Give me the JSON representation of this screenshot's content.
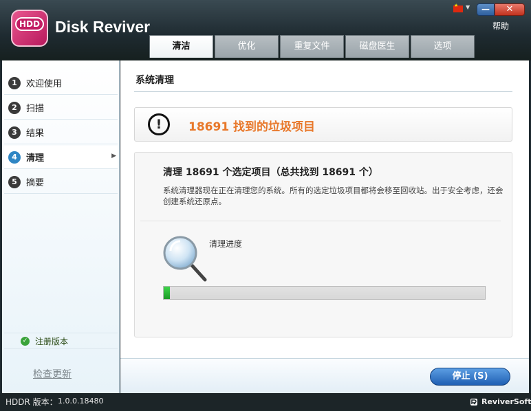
{
  "app": {
    "logo_text": "HDD",
    "title": "Disk Reviver",
    "help": "帮助",
    "minimize": "—",
    "close": "✕"
  },
  "tabs": [
    {
      "label": "清洁",
      "active": true
    },
    {
      "label": "优化",
      "active": false
    },
    {
      "label": "重复文件",
      "active": false
    },
    {
      "label": "磁盘医生",
      "active": false
    },
    {
      "label": "选项",
      "active": false
    }
  ],
  "sidebar": {
    "items": [
      {
        "num": "1",
        "label": "欢迎使用"
      },
      {
        "num": "2",
        "label": "扫描"
      },
      {
        "num": "3",
        "label": "结果"
      },
      {
        "num": "4",
        "label": "清理",
        "active": true
      },
      {
        "num": "5",
        "label": "摘要"
      }
    ],
    "registered": "注册版本",
    "check_update": "检查更新"
  },
  "main": {
    "section_title": "系统清理",
    "alert": "18691 找到的垃圾项目",
    "heading": "清理 18691 个选定项目（总共找到 18691 个）",
    "description": "系统清理器现在正在清理您的系统。所有的选定垃圾项目都将会移至回收站。出于安全考虑，还会创建系统还原点。",
    "progress_label": "清理进度",
    "progress_fraction": 0.02,
    "stop_button": "停止 (S)"
  },
  "status": {
    "version_label": "HDDR 版本：",
    "version_value": "1.0.0.18480",
    "brand": "ReviverSoft"
  },
  "colors": {
    "accent_orange": "#e8782a",
    "progress_green": "#2bb63a",
    "button_blue": "#2f6fc3"
  }
}
